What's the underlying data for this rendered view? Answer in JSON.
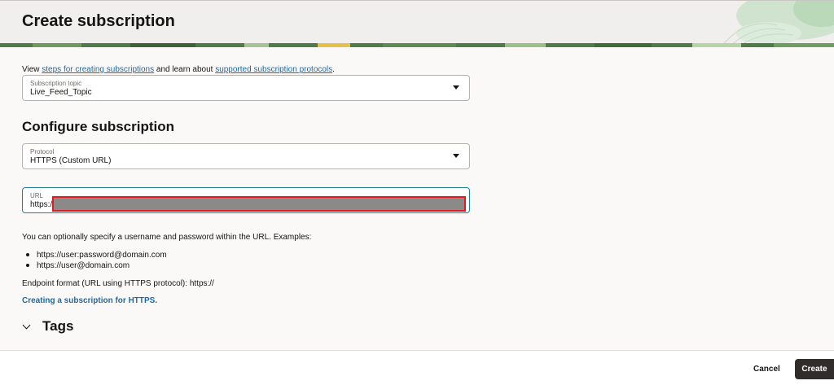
{
  "header": {
    "title": "Create subscription"
  },
  "intro": {
    "prefix": "View ",
    "link1": "steps for creating subscriptions",
    "middle": " and learn about ",
    "link2": "supported subscription protocols",
    "suffix": "."
  },
  "topic_field": {
    "label": "Subscription topic",
    "value": "Live_Feed_Topic"
  },
  "configure": {
    "title": "Configure subscription"
  },
  "protocol_field": {
    "label": "Protocol",
    "value": "HTTPS (Custom URL)"
  },
  "url_field": {
    "label": "URL",
    "value": "https:/"
  },
  "help": {
    "optional_text": "You can optionally specify a username and password within the URL. Examples:",
    "examples": [
      "https://user:password@domain.com",
      "https://user@domain.com"
    ],
    "endpoint_format": "Endpoint format (URL using HTTPS protocol): https://",
    "link": "Creating a subscription for HTTPS."
  },
  "tags": {
    "label": "Tags"
  },
  "footer": {
    "cancel_label": "Cancel",
    "create_label": "Create"
  },
  "colors": {
    "link": "#1b6aa3",
    "primary_button": "#312d2a",
    "focus_border": "#227e9e",
    "redaction_border": "#e01b24",
    "redaction_fill": "#8c8a88"
  }
}
